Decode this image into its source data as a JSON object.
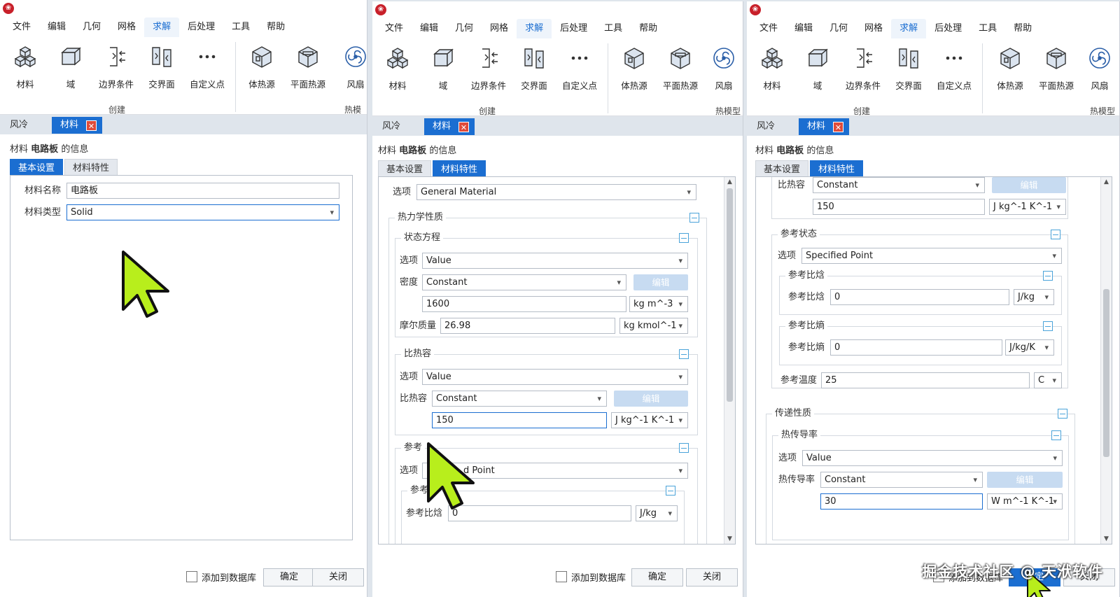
{
  "menu": [
    "文件",
    "编辑",
    "几何",
    "网格",
    "求解",
    "后处理",
    "工具",
    "帮助"
  ],
  "ribbon": {
    "buttons": [
      "材料",
      "域",
      "边界条件",
      "交界面",
      "自定义点",
      "体热源",
      "平面热源",
      "风扇"
    ],
    "groups": [
      "创建",
      "热模型"
    ]
  },
  "doc_tabs": [
    "风冷",
    "材料"
  ],
  "close_glyph": "✕",
  "info_title": {
    "prefix": "材料",
    "name": "电路板",
    "suffix": "的信息"
  },
  "sub_tabs": [
    "基本设置",
    "材料特性"
  ],
  "basic": {
    "name_label": "材料名称",
    "name_value": "电路板",
    "type_label": "材料类型",
    "type_value": "Solid"
  },
  "props": {
    "option_label": "选项",
    "option_value": "General Material",
    "thermo_title": "热力学性质",
    "eos_title": "状态方程",
    "eos_option": "Value",
    "density_label": "密度",
    "density_mode": "Constant",
    "density_value": "1600",
    "density_unit": "kg m^-3",
    "molar_label": "摩尔质量",
    "molar_value": "26.98",
    "molar_unit": "kg kmol^-1",
    "cp_title": "比热容",
    "cp_option": "Value",
    "cp_label": "比热容",
    "cp_mode": "Constant",
    "cp_value": "150",
    "cp_unit": "J kg^-1 K^-1",
    "edit_label": "编辑",
    "ref_title": "参考状态",
    "ref_option": "Specified Point",
    "ref_option_visible": "d Point",
    "ref_title_visible": "参考",
    "ref_h_title_visible": "参考比",
    "ref_h_title": "参考比焓",
    "ref_h_label": "参考比焓",
    "ref_h_value": "0",
    "ref_h_unit": "J/kg",
    "ref_s_title": "参考比熵",
    "ref_s_label": "参考比熵",
    "ref_s_value": "0",
    "ref_s_unit": "J/kg/K",
    "ref_s_title_visible": "参考比熵",
    "ref_t_label": "参考温度",
    "ref_t_value": "25",
    "ref_t_unit": "C",
    "transport_title": "传递性质",
    "k_title": "热传导率",
    "k_option": "Value",
    "k_label": "热传导率",
    "k_mode": "Constant",
    "k_value": "30",
    "k_unit": "W m^-1 K^-1"
  },
  "footer": {
    "add_db": "添加到数据库",
    "ok": "确定",
    "close": "关闭"
  },
  "watermark": "掘金技术社区 @ 天洑软件",
  "colors": {
    "accent": "#1b6ed1",
    "cursor": "#b8ee1c",
    "close": "#e04b3a"
  }
}
